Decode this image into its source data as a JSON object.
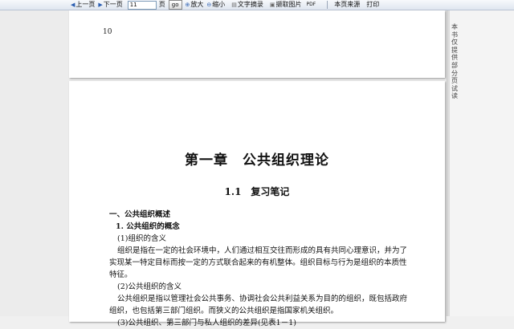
{
  "toolbar": {
    "prev_label": "上一页",
    "next_label": "下一页",
    "page_value": "11",
    "page_suffix": "页",
    "go_label": "go",
    "zoom_in_label": "放大",
    "zoom_out_label": "缩小",
    "text_excerpt_label": "文字摘录",
    "capture_image_label": "撷取图片",
    "pdf_label": "PDF",
    "source_label": "本页来源",
    "print_label": "打印"
  },
  "pages": {
    "previous_page_number": "10"
  },
  "document": {
    "chapter_title": "第一章　公共组织理论",
    "section_title": "1.1　复习笔记",
    "lines": [
      "一、公共组织概述",
      "1. 公共组织的概念",
      "(1)组织的含义",
      "组织是指在一定的社会环境中，人们通过相互交往而形成的具有共同心理意识，并为了",
      "实现某一特定目标而按一定的方式联合起来的有机整体。组织目标与行为是组织的本质性",
      "特征。",
      "(2)公共组织的含义",
      "公共组织是指以管理社会公共事务、协调社会公共利益关系为目的的组织，既包括政府",
      "组织，也包括第三部门组织。而狭义的公共组织是指国家机关组织。",
      "(3)公共组织、第三部门与私人组织的差异(见表1－1)"
    ]
  },
  "side_panel": {
    "note": "本书仅提供部分页试读"
  }
}
